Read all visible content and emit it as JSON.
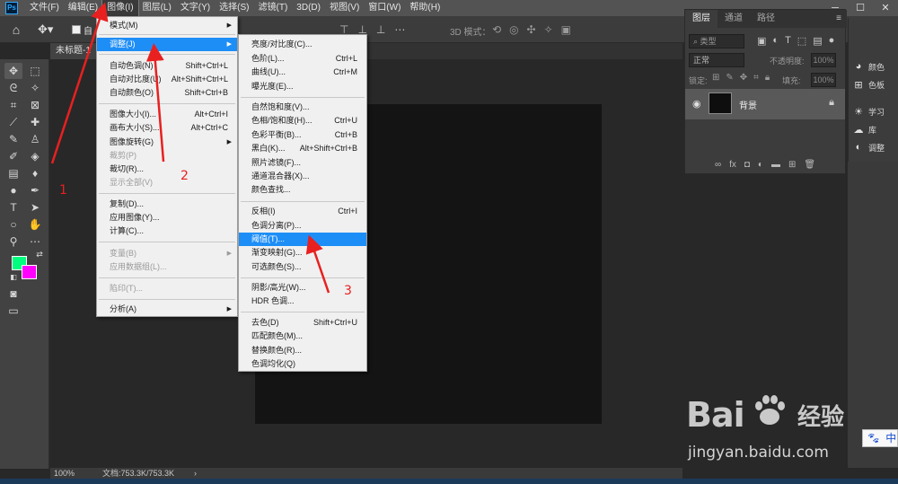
{
  "menubar": {
    "items": [
      "文件(F)",
      "编辑(E)",
      "图像(I)",
      "图层(L)",
      "文字(Y)",
      "选择(S)",
      "滤镜(T)",
      "3D(D)",
      "视图(V)",
      "窗口(W)",
      "帮助(H)"
    ]
  },
  "options": {
    "auto_select": "自",
    "mode3d": "3D 模式："
  },
  "document": {
    "tab_name": "未标题-1",
    "zoom": "100%",
    "doc_size": "文档:753.3K/753.3K",
    "status_arrow": "›"
  },
  "image_menu": [
    {
      "label": "模式(M)",
      "shortcut": "",
      "submenu": true,
      "disabled": false
    },
    {
      "label": "调整(J)",
      "shortcut": "",
      "submenu": true,
      "disabled": false,
      "highlighted": true
    },
    {
      "label": "自动色调(N)",
      "shortcut": "Shift+Ctrl+L",
      "disabled": false
    },
    {
      "label": "自动对比度(U)",
      "shortcut": "Alt+Shift+Ctrl+L",
      "disabled": false
    },
    {
      "label": "自动颜色(O)",
      "shortcut": "Shift+Ctrl+B",
      "disabled": false
    },
    {
      "label": "图像大小(I)...",
      "shortcut": "Alt+Ctrl+I",
      "disabled": false
    },
    {
      "label": "画布大小(S)...",
      "shortcut": "Alt+Ctrl+C",
      "disabled": false
    },
    {
      "label": "图像旋转(G)",
      "shortcut": "",
      "submenu": true,
      "disabled": false
    },
    {
      "label": "裁剪(P)",
      "shortcut": "",
      "disabled": true
    },
    {
      "label": "裁切(R)...",
      "shortcut": "",
      "disabled": false
    },
    {
      "label": "显示全部(V)",
      "shortcut": "",
      "disabled": true
    },
    {
      "label": "复制(D)...",
      "shortcut": "",
      "disabled": false
    },
    {
      "label": "应用图像(Y)...",
      "shortcut": "",
      "disabled": false
    },
    {
      "label": "计算(C)...",
      "shortcut": "",
      "disabled": false
    },
    {
      "label": "变量(B)",
      "shortcut": "",
      "submenu": true,
      "disabled": true
    },
    {
      "label": "应用数据组(L)...",
      "shortcut": "",
      "disabled": true
    },
    {
      "label": "陷印(T)...",
      "shortcut": "",
      "disabled": true
    },
    {
      "label": "分析(A)",
      "shortcut": "",
      "submenu": true,
      "disabled": false
    }
  ],
  "adjust_menu": [
    {
      "label": "亮度/对比度(C)...",
      "shortcut": ""
    },
    {
      "label": "色阶(L)...",
      "shortcut": "Ctrl+L"
    },
    {
      "label": "曲线(U)...",
      "shortcut": "Ctrl+M"
    },
    {
      "label": "曝光度(E)...",
      "shortcut": ""
    },
    {
      "label": "自然饱和度(V)...",
      "shortcut": ""
    },
    {
      "label": "色相/饱和度(H)...",
      "shortcut": "Ctrl+U"
    },
    {
      "label": "色彩平衡(B)...",
      "shortcut": "Ctrl+B"
    },
    {
      "label": "黑白(K)...",
      "shortcut": "Alt+Shift+Ctrl+B"
    },
    {
      "label": "照片滤镜(F)...",
      "shortcut": ""
    },
    {
      "label": "通道混合器(X)...",
      "shortcut": ""
    },
    {
      "label": "颜色查找...",
      "shortcut": ""
    },
    {
      "label": "反相(I)",
      "shortcut": "Ctrl+I"
    },
    {
      "label": "色调分离(P)...",
      "shortcut": ""
    },
    {
      "label": "阈值(T)...",
      "shortcut": "",
      "highlighted": true
    },
    {
      "label": "渐变映射(G)...",
      "shortcut": ""
    },
    {
      "label": "可选颜色(S)...",
      "shortcut": ""
    },
    {
      "label": "阴影/高光(W)...",
      "shortcut": ""
    },
    {
      "label": "HDR 色调...",
      "shortcut": ""
    },
    {
      "label": "去色(D)",
      "shortcut": "Shift+Ctrl+U"
    },
    {
      "label": "匹配颜色(M)...",
      "shortcut": ""
    },
    {
      "label": "替换颜色(R)...",
      "shortcut": ""
    },
    {
      "label": "色调均化(Q)",
      "shortcut": ""
    }
  ],
  "layers_panel": {
    "tabs": [
      "图层",
      "通道",
      "路径"
    ],
    "filter": "类型",
    "blend": "正常",
    "opacity_label": "不透明度:",
    "opacity_value": "100%",
    "lock_label": "锁定:",
    "fill_label": "填充:",
    "fill_value": "100%",
    "layer_name": "背景"
  },
  "side_panel": {
    "items": [
      "颜色",
      "色板",
      "学习",
      "库",
      "调整"
    ]
  },
  "annotations": [
    "1",
    "2",
    "3"
  ],
  "watermark": {
    "brand": "Bai",
    "brand_cn": "经验",
    "url": "jingyan.baidu.com"
  },
  "ime": {
    "cn": "中"
  },
  "colors": {
    "foreground": "#00ff7f",
    "background": "#ff00ff",
    "highlight": "#1e8ef7",
    "annotation": "#e82020"
  }
}
